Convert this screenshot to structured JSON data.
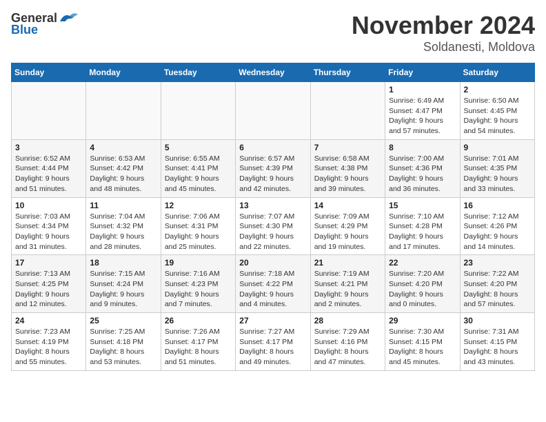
{
  "logo": {
    "general": "General",
    "blue": "Blue"
  },
  "title": "November 2024",
  "subtitle": "Soldanesti, Moldova",
  "days_of_week": [
    "Sunday",
    "Monday",
    "Tuesday",
    "Wednesday",
    "Thursday",
    "Friday",
    "Saturday"
  ],
  "weeks": [
    [
      {
        "day": "",
        "info": ""
      },
      {
        "day": "",
        "info": ""
      },
      {
        "day": "",
        "info": ""
      },
      {
        "day": "",
        "info": ""
      },
      {
        "day": "",
        "info": ""
      },
      {
        "day": "1",
        "info": "Sunrise: 6:49 AM\nSunset: 4:47 PM\nDaylight: 9 hours and 57 minutes."
      },
      {
        "day": "2",
        "info": "Sunrise: 6:50 AM\nSunset: 4:45 PM\nDaylight: 9 hours and 54 minutes."
      }
    ],
    [
      {
        "day": "3",
        "info": "Sunrise: 6:52 AM\nSunset: 4:44 PM\nDaylight: 9 hours and 51 minutes."
      },
      {
        "day": "4",
        "info": "Sunrise: 6:53 AM\nSunset: 4:42 PM\nDaylight: 9 hours and 48 minutes."
      },
      {
        "day": "5",
        "info": "Sunrise: 6:55 AM\nSunset: 4:41 PM\nDaylight: 9 hours and 45 minutes."
      },
      {
        "day": "6",
        "info": "Sunrise: 6:57 AM\nSunset: 4:39 PM\nDaylight: 9 hours and 42 minutes."
      },
      {
        "day": "7",
        "info": "Sunrise: 6:58 AM\nSunset: 4:38 PM\nDaylight: 9 hours and 39 minutes."
      },
      {
        "day": "8",
        "info": "Sunrise: 7:00 AM\nSunset: 4:36 PM\nDaylight: 9 hours and 36 minutes."
      },
      {
        "day": "9",
        "info": "Sunrise: 7:01 AM\nSunset: 4:35 PM\nDaylight: 9 hours and 33 minutes."
      }
    ],
    [
      {
        "day": "10",
        "info": "Sunrise: 7:03 AM\nSunset: 4:34 PM\nDaylight: 9 hours and 31 minutes."
      },
      {
        "day": "11",
        "info": "Sunrise: 7:04 AM\nSunset: 4:32 PM\nDaylight: 9 hours and 28 minutes."
      },
      {
        "day": "12",
        "info": "Sunrise: 7:06 AM\nSunset: 4:31 PM\nDaylight: 9 hours and 25 minutes."
      },
      {
        "day": "13",
        "info": "Sunrise: 7:07 AM\nSunset: 4:30 PM\nDaylight: 9 hours and 22 minutes."
      },
      {
        "day": "14",
        "info": "Sunrise: 7:09 AM\nSunset: 4:29 PM\nDaylight: 9 hours and 19 minutes."
      },
      {
        "day": "15",
        "info": "Sunrise: 7:10 AM\nSunset: 4:28 PM\nDaylight: 9 hours and 17 minutes."
      },
      {
        "day": "16",
        "info": "Sunrise: 7:12 AM\nSunset: 4:26 PM\nDaylight: 9 hours and 14 minutes."
      }
    ],
    [
      {
        "day": "17",
        "info": "Sunrise: 7:13 AM\nSunset: 4:25 PM\nDaylight: 9 hours and 12 minutes."
      },
      {
        "day": "18",
        "info": "Sunrise: 7:15 AM\nSunset: 4:24 PM\nDaylight: 9 hours and 9 minutes."
      },
      {
        "day": "19",
        "info": "Sunrise: 7:16 AM\nSunset: 4:23 PM\nDaylight: 9 hours and 7 minutes."
      },
      {
        "day": "20",
        "info": "Sunrise: 7:18 AM\nSunset: 4:22 PM\nDaylight: 9 hours and 4 minutes."
      },
      {
        "day": "21",
        "info": "Sunrise: 7:19 AM\nSunset: 4:21 PM\nDaylight: 9 hours and 2 minutes."
      },
      {
        "day": "22",
        "info": "Sunrise: 7:20 AM\nSunset: 4:20 PM\nDaylight: 9 hours and 0 minutes."
      },
      {
        "day": "23",
        "info": "Sunrise: 7:22 AM\nSunset: 4:20 PM\nDaylight: 8 hours and 57 minutes."
      }
    ],
    [
      {
        "day": "24",
        "info": "Sunrise: 7:23 AM\nSunset: 4:19 PM\nDaylight: 8 hours and 55 minutes."
      },
      {
        "day": "25",
        "info": "Sunrise: 7:25 AM\nSunset: 4:18 PM\nDaylight: 8 hours and 53 minutes."
      },
      {
        "day": "26",
        "info": "Sunrise: 7:26 AM\nSunset: 4:17 PM\nDaylight: 8 hours and 51 minutes."
      },
      {
        "day": "27",
        "info": "Sunrise: 7:27 AM\nSunset: 4:17 PM\nDaylight: 8 hours and 49 minutes."
      },
      {
        "day": "28",
        "info": "Sunrise: 7:29 AM\nSunset: 4:16 PM\nDaylight: 8 hours and 47 minutes."
      },
      {
        "day": "29",
        "info": "Sunrise: 7:30 AM\nSunset: 4:15 PM\nDaylight: 8 hours and 45 minutes."
      },
      {
        "day": "30",
        "info": "Sunrise: 7:31 AM\nSunset: 4:15 PM\nDaylight: 8 hours and 43 minutes."
      }
    ]
  ]
}
